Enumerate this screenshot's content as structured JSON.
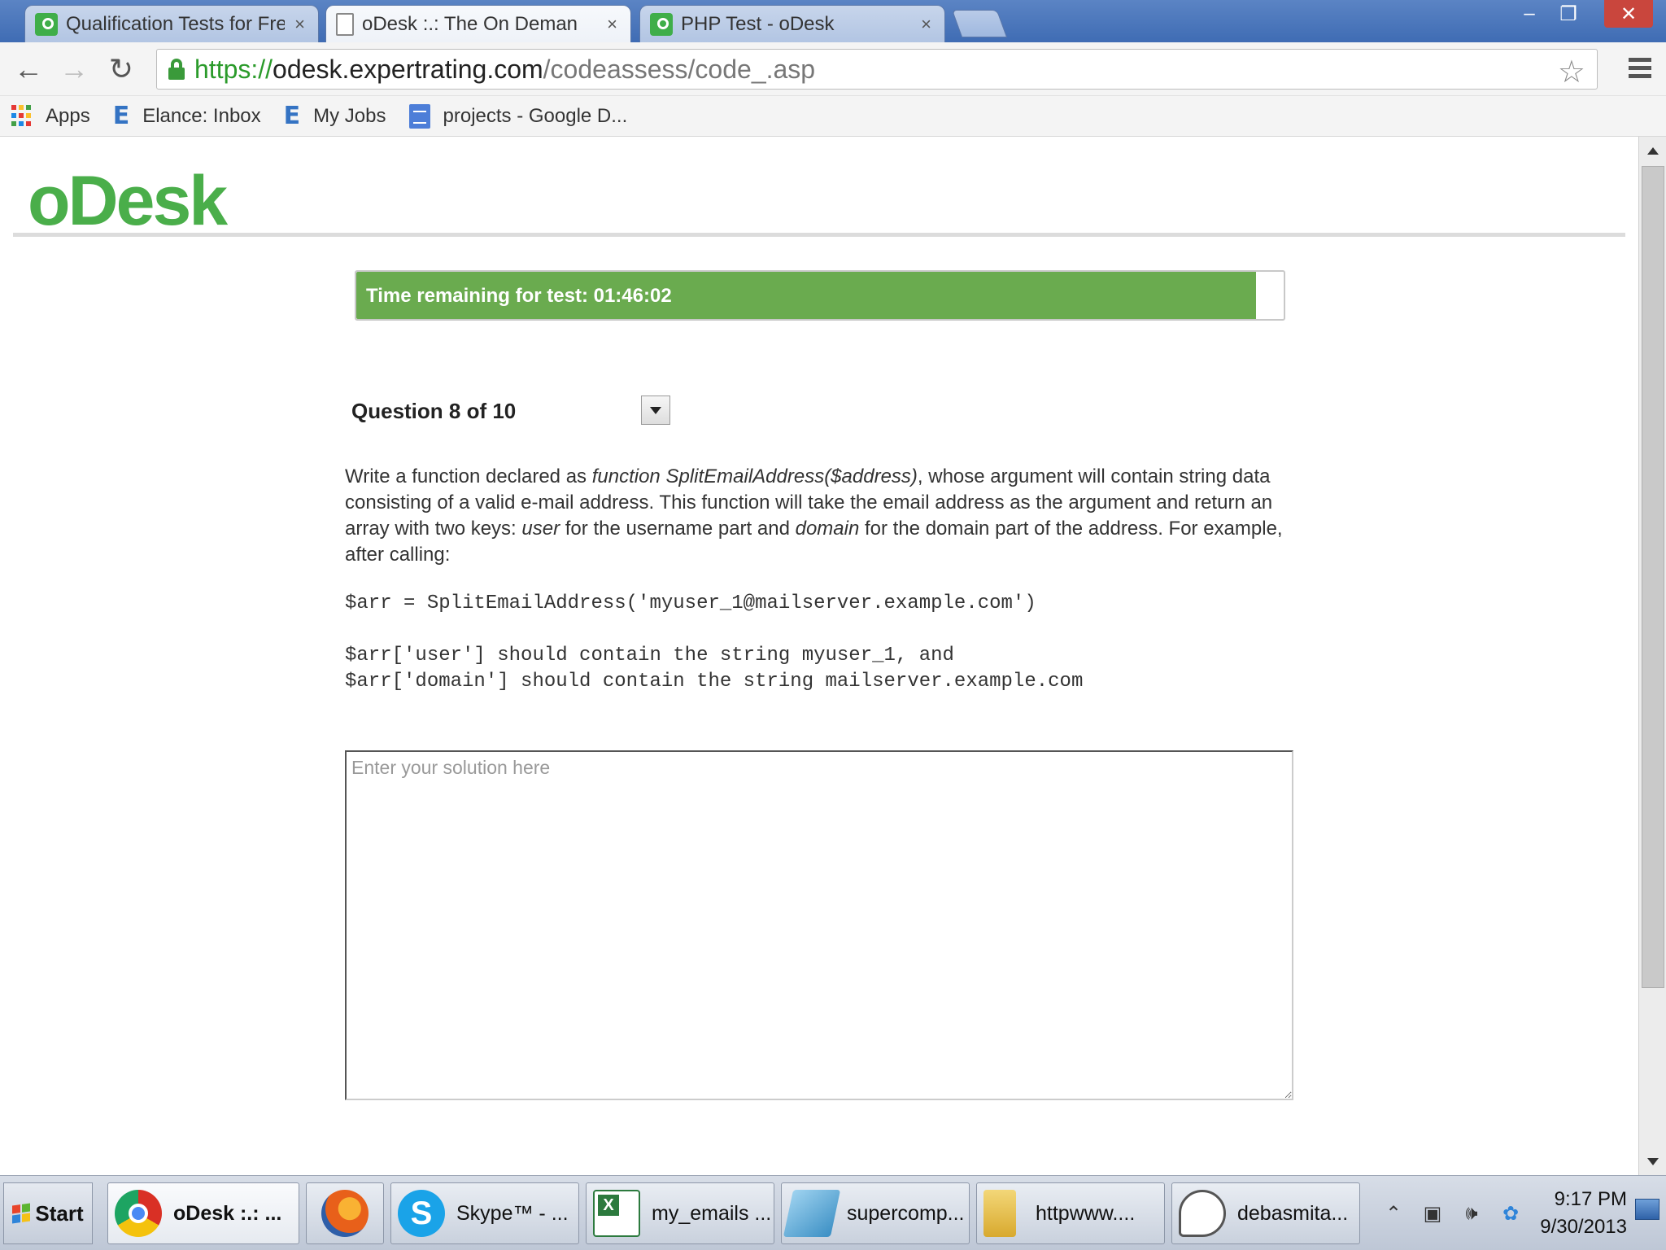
{
  "browser": {
    "tabs": [
      {
        "title": "Qualification Tests for Fre",
        "active": false,
        "icon": "odesk-favicon"
      },
      {
        "title": "oDesk :.: The On Deman",
        "active": true,
        "icon": "document-favicon"
      },
      {
        "title": "PHP Test - oDesk",
        "active": false,
        "icon": "odesk-favicon"
      }
    ],
    "close_glyph": "×",
    "window_controls": {
      "minimize": "‒",
      "restore": "❐",
      "close": "✕"
    },
    "nav": {
      "back": "←",
      "forward": "→",
      "reload": "↻"
    },
    "url": {
      "scheme": "https://",
      "host": "odesk.expertrating.com",
      "path": "/codeassess/code_.asp"
    },
    "bookmark_star": "☆",
    "bookmarks": [
      {
        "label": "Apps",
        "icon": "apps-grid-icon"
      },
      {
        "label": "Elance: Inbox",
        "icon": "elance-icon"
      },
      {
        "label": "My Jobs",
        "icon": "elance-icon"
      },
      {
        "label": "projects - Google D...",
        "icon": "google-docs-icon"
      }
    ],
    "elance_glyph": "E"
  },
  "page": {
    "logo": "oDesk",
    "timer": {
      "label": "Time remaining for test: 01:46:02",
      "progress_fraction": 0.97
    },
    "question_header": "Question 8 of 10",
    "prompt": {
      "p1": "Write a function declared as ",
      "fn": "function SplitEmailAddress($address)",
      "p2": ", whose argument will contain string data consisting of a valid e-mail address. This function will take the email address as the argument and return an array with two keys: ",
      "user": "user",
      "p3": " for the username part and ",
      "domain": "domain",
      "p4": " for the domain part of the address. For example, after calling:"
    },
    "code_example": "$arr = SplitEmailAddress('myuser_1@mailserver.example.com')",
    "code_result": "$arr['user'] should contain the string myuser_1, and\n$arr['domain'] should contain the string mailserver.example.com",
    "solution_placeholder": "Enter your solution here"
  },
  "taskbar": {
    "start_label": "Start",
    "buttons": [
      {
        "label": "oDesk :.: ...",
        "icon": "chrome-icon",
        "active": true
      },
      {
        "label": "",
        "icon": "firefox-icon",
        "active": false
      },
      {
        "label": "Skype™ - ...",
        "icon": "skype-icon",
        "active": false
      },
      {
        "label": "my_emails ...",
        "icon": "excel-icon",
        "active": false
      },
      {
        "label": "supercomp...",
        "icon": "notepad-icon",
        "active": false
      },
      {
        "label": "httpwww....",
        "icon": "folder-icon",
        "active": false
      },
      {
        "label": "debasmita...",
        "icon": "chat-icon",
        "active": false
      }
    ],
    "skype_glyph": "S",
    "tray_icons": [
      "show-hidden-icons-icon",
      "network-icon",
      "volume-icon",
      "sync-icon"
    ],
    "tray_glyphs": [
      "⌃",
      "▣",
      "🕪",
      "✿"
    ],
    "clock": {
      "time": "9:17 PM",
      "date": "9/30/2013"
    }
  },
  "colors": {
    "brand_green": "#4aae4a",
    "timer_green": "#6aab4f",
    "url_green": "#2b9b2b",
    "tabbar_blue": "#4a77bc"
  }
}
